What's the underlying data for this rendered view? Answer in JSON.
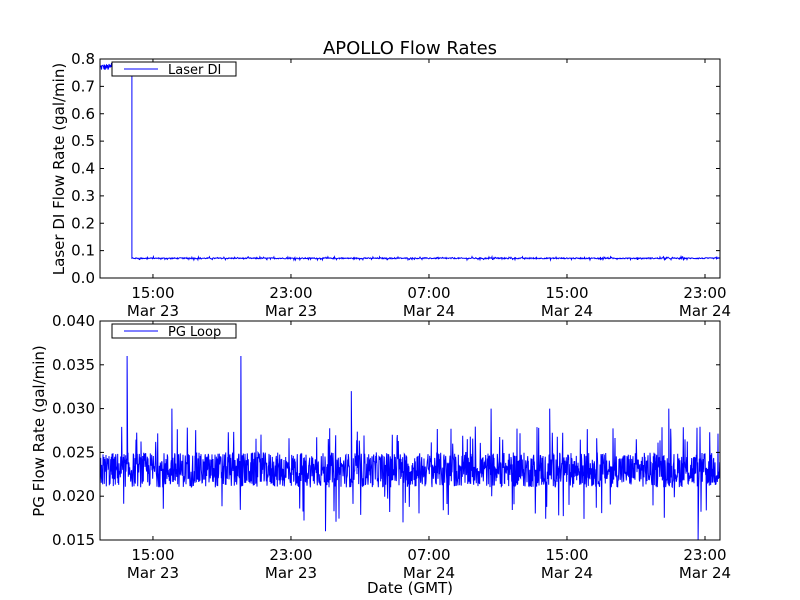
{
  "chart_data": [
    {
      "type": "line",
      "title": "APOLLO Flow Rates",
      "xlabel": "",
      "ylabel": "Laser DI Flow Rate (gal/min)",
      "x_units": "hours since Mar 23 00:00 GMT",
      "xlim": [
        11.93,
        47.87
      ],
      "ylim": [
        0.0,
        0.8
      ],
      "yticks": [
        "0.0",
        "0.1",
        "0.2",
        "0.3",
        "0.4",
        "0.5",
        "0.6",
        "0.7",
        "0.8"
      ],
      "xticks": [
        {
          "value": 15,
          "time": "15:00",
          "date": "Mar 23"
        },
        {
          "value": 23,
          "time": "23:00",
          "date": "Mar 23"
        },
        {
          "value": 31,
          "time": "07:00",
          "date": "Mar 24"
        },
        {
          "value": 39,
          "time": "15:00",
          "date": "Mar 24"
        },
        {
          "value": 47,
          "time": "23:00",
          "date": "Mar 24"
        }
      ],
      "legend": {
        "label": "Laser DI",
        "placement": "top-left"
      },
      "series": [
        {
          "name": "Laser DI",
          "color": "#0000ff",
          "segments": [
            {
              "from": 11.93,
              "to": 13.78,
              "level": 0.77,
              "noise": 0.025
            },
            {
              "from": 13.78,
              "to": 47.87,
              "level": 0.072,
              "noise": 0.004
            }
          ]
        }
      ]
    },
    {
      "type": "line",
      "xlabel": "Date (GMT)",
      "ylabel": "PG Flow Rate (gal/min)",
      "xlim": [
        11.93,
        47.87
      ],
      "ylim": [
        0.015,
        0.04
      ],
      "yticks": [
        "0.015",
        "0.020",
        "0.025",
        "0.030",
        "0.035",
        "0.040"
      ],
      "xticks": [
        {
          "value": 15,
          "time": "15:00",
          "date": "Mar 23"
        },
        {
          "value": 23,
          "time": "23:00",
          "date": "Mar 23"
        },
        {
          "value": 31,
          "time": "07:00",
          "date": "Mar 24"
        },
        {
          "value": 39,
          "time": "15:00",
          "date": "Mar 24"
        },
        {
          "value": 47,
          "time": "23:00",
          "date": "Mar 24"
        }
      ],
      "legend": {
        "label": "PG Loop",
        "placement": "top-left"
      },
      "series": [
        {
          "name": "PG Loop",
          "color": "#0000ff",
          "band": [
            0.021,
            0.025
          ],
          "spikes": [
            {
              "x": 13.5,
              "y": 0.036
            },
            {
              "x": 20.1,
              "y": 0.036
            },
            {
              "x": 26.5,
              "y": 0.032
            },
            {
              "x": 46.6,
              "y": 0.015
            },
            {
              "x": 16.1,
              "y": 0.03
            },
            {
              "x": 25.0,
              "y": 0.016
            },
            {
              "x": 34.6,
              "y": 0.03
            },
            {
              "x": 38.0,
              "y": 0.03
            },
            {
              "x": 44.9,
              "y": 0.03
            }
          ]
        }
      ]
    }
  ]
}
